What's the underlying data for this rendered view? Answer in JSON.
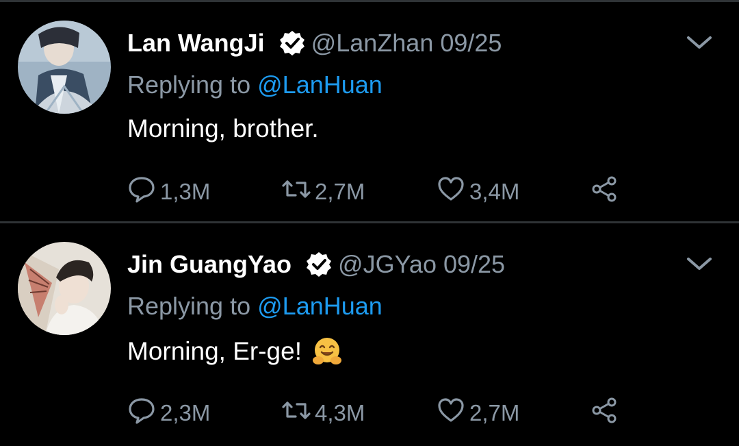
{
  "tweets": [
    {
      "name": "Lan WangJi",
      "handle": "@LanZhan",
      "date": "09/25",
      "reply_prefix": "Replying to",
      "reply_to": "@LanHuan",
      "text": "Morning, brother.",
      "emoji": "",
      "replies": "1,3M",
      "retweets": "2,7M",
      "likes": "3,4M",
      "avatar_colors": [
        "#9fb3c4",
        "#3a4d63",
        "#e8edf2"
      ]
    },
    {
      "name": "Jin GuangYao",
      "handle": "@JGYao",
      "date": "09/25",
      "reply_prefix": "Replying to",
      "reply_to": "@LanHuan",
      "text": "Morning, Er-ge!",
      "emoji": "hugging-face",
      "replies": "2,3M",
      "retweets": "4,3M",
      "likes": "2,7M",
      "avatar_colors": [
        "#e6e1d9",
        "#2b2522",
        "#c26a5a"
      ]
    }
  ],
  "colors": {
    "background": "#000000",
    "text": "#ffffff",
    "muted": "#8b98a5",
    "link": "#1d9bf0",
    "divider": "#2f3336"
  },
  "icons": {
    "verified": "verified-badge-icon",
    "more": "chevron-down-icon",
    "reply": "speech-bubble-icon",
    "retweet": "retweet-arrows-icon",
    "like": "heart-icon",
    "share": "share-nodes-icon"
  }
}
